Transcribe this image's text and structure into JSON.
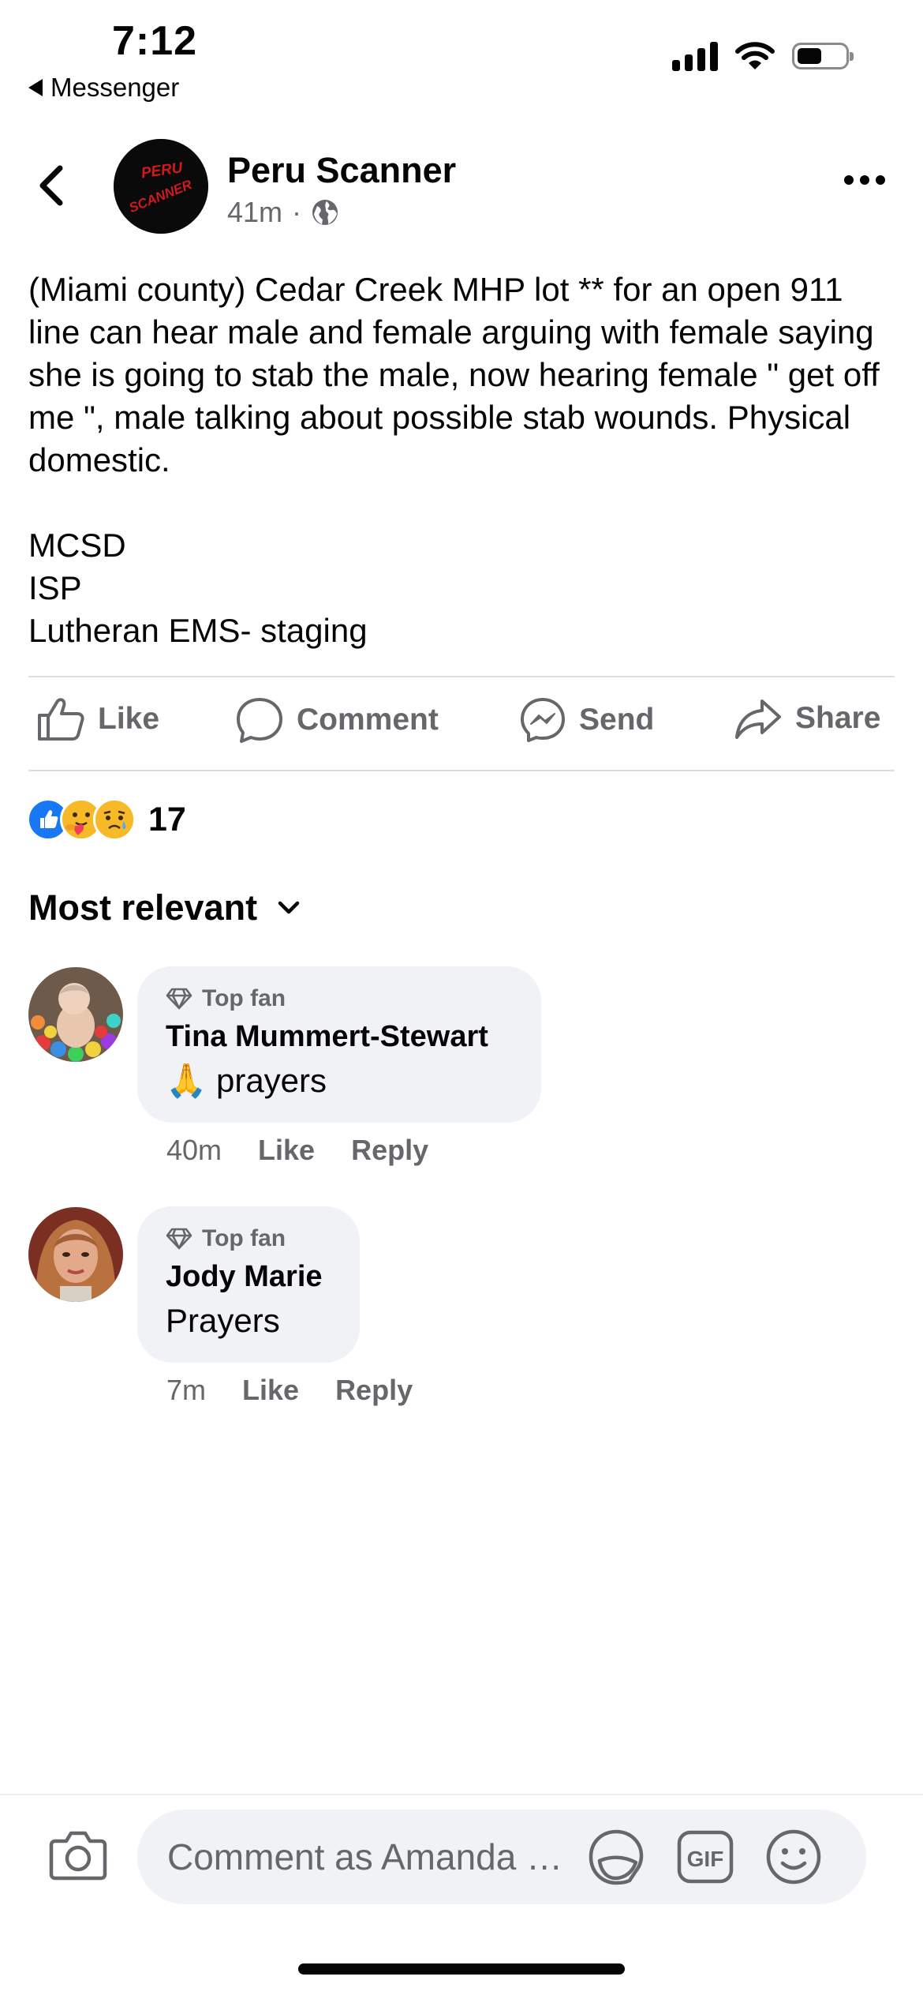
{
  "status_bar": {
    "time": "7:12",
    "back_app": "Messenger",
    "icons": [
      "cellular-signal-icon",
      "wifi-icon",
      "battery-icon"
    ],
    "battery_level": 0.45
  },
  "post": {
    "page_name": "Peru Scanner",
    "avatar_text": [
      "PERU",
      "SCANNER"
    ],
    "time_ago": "41m",
    "separator": "·",
    "audience_icon": "globe-icon",
    "body": "(Miami county) Cedar Creek MHP lot ** for an open 911 line can hear male and female arguing with female saying  she is going to stab the male, now hearing female \" get off me \", male talking about possible stab wounds. Physical domestic.\n\nMCSD\nISP\nLutheran EMS- staging"
  },
  "actions": {
    "like": "Like",
    "comment": "Comment",
    "send": "Send",
    "share": "Share"
  },
  "reactions": {
    "types": [
      "like",
      "care",
      "sad"
    ],
    "count": "17"
  },
  "sort": {
    "label": "Most relevant"
  },
  "comments": [
    {
      "badge": "Top fan",
      "name": "Tina Mummert-Stewart",
      "emoji": "🙏",
      "text": "prayers",
      "time": "40m",
      "like": "Like",
      "reply": "Reply"
    },
    {
      "badge": "Top fan",
      "name": "Jody Marie",
      "text": "Prayers",
      "time": "7m",
      "like": "Like",
      "reply": "Reply"
    }
  ],
  "composer": {
    "placeholder": "Comment as Amanda S...",
    "gif_label": "GIF",
    "icons": [
      "camera-icon",
      "sticker-icon",
      "gif-icon",
      "emoji-icon"
    ]
  },
  "colors": {
    "facebook_blue": "#1877f2",
    "secondary_text": "#65676b",
    "bubble_bg": "#f0f2f5",
    "scanner_red": "#d11a1a"
  }
}
